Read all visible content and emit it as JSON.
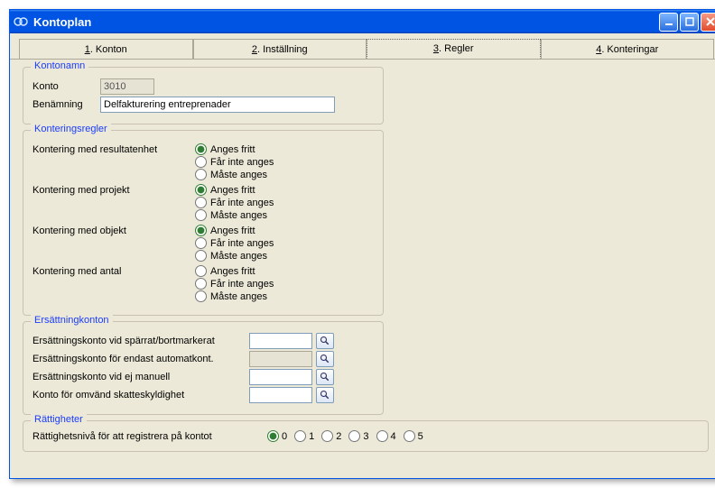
{
  "window": {
    "title": "Kontoplan"
  },
  "tabs": {
    "t1_num": "1",
    "t1_txt": ". Konton",
    "t2_num": "2",
    "t2_txt": ". Inställning",
    "t3_num": "3",
    "t3_txt": ". Regler",
    "t4_num": "4",
    "t4_txt": ". Konteringar"
  },
  "kontonamn": {
    "legend": "Kontonamn",
    "konto_label": "Konto",
    "konto_value": "3010",
    "benamning_label": "Benämning",
    "benamning_value": "Delfakturering entreprenader"
  },
  "konteringsregler": {
    "legend": "Konteringsregler",
    "option_fritt": "Anges fritt",
    "option_inte": "Får inte anges",
    "option_maste": "Måste anges",
    "resultatenhet_label": "Kontering med resultatenhet",
    "projekt_label": "Kontering med projekt",
    "objekt_label": "Kontering med objekt",
    "antal_label": "Kontering med antal"
  },
  "ersattning": {
    "legend": "Ersättningkonton",
    "sparrat_label": "Ersättningskonto vid spärrat/bortmarkerat",
    "automat_label": "Ersättningskonto för endast automatkont.",
    "ejmanuell_label": "Ersättningskonto vid ej manuell",
    "omvand_label": "Konto för omvänd skatteskyldighet",
    "sparrat_value": "",
    "automat_value": "",
    "ejmanuell_value": "",
    "omvand_value": ""
  },
  "rattigheter": {
    "legend": "Rättigheter",
    "label": "Rättighetsnivå för att registrera på kontot",
    "opts": [
      "0",
      "1",
      "2",
      "3",
      "4",
      "5"
    ]
  }
}
